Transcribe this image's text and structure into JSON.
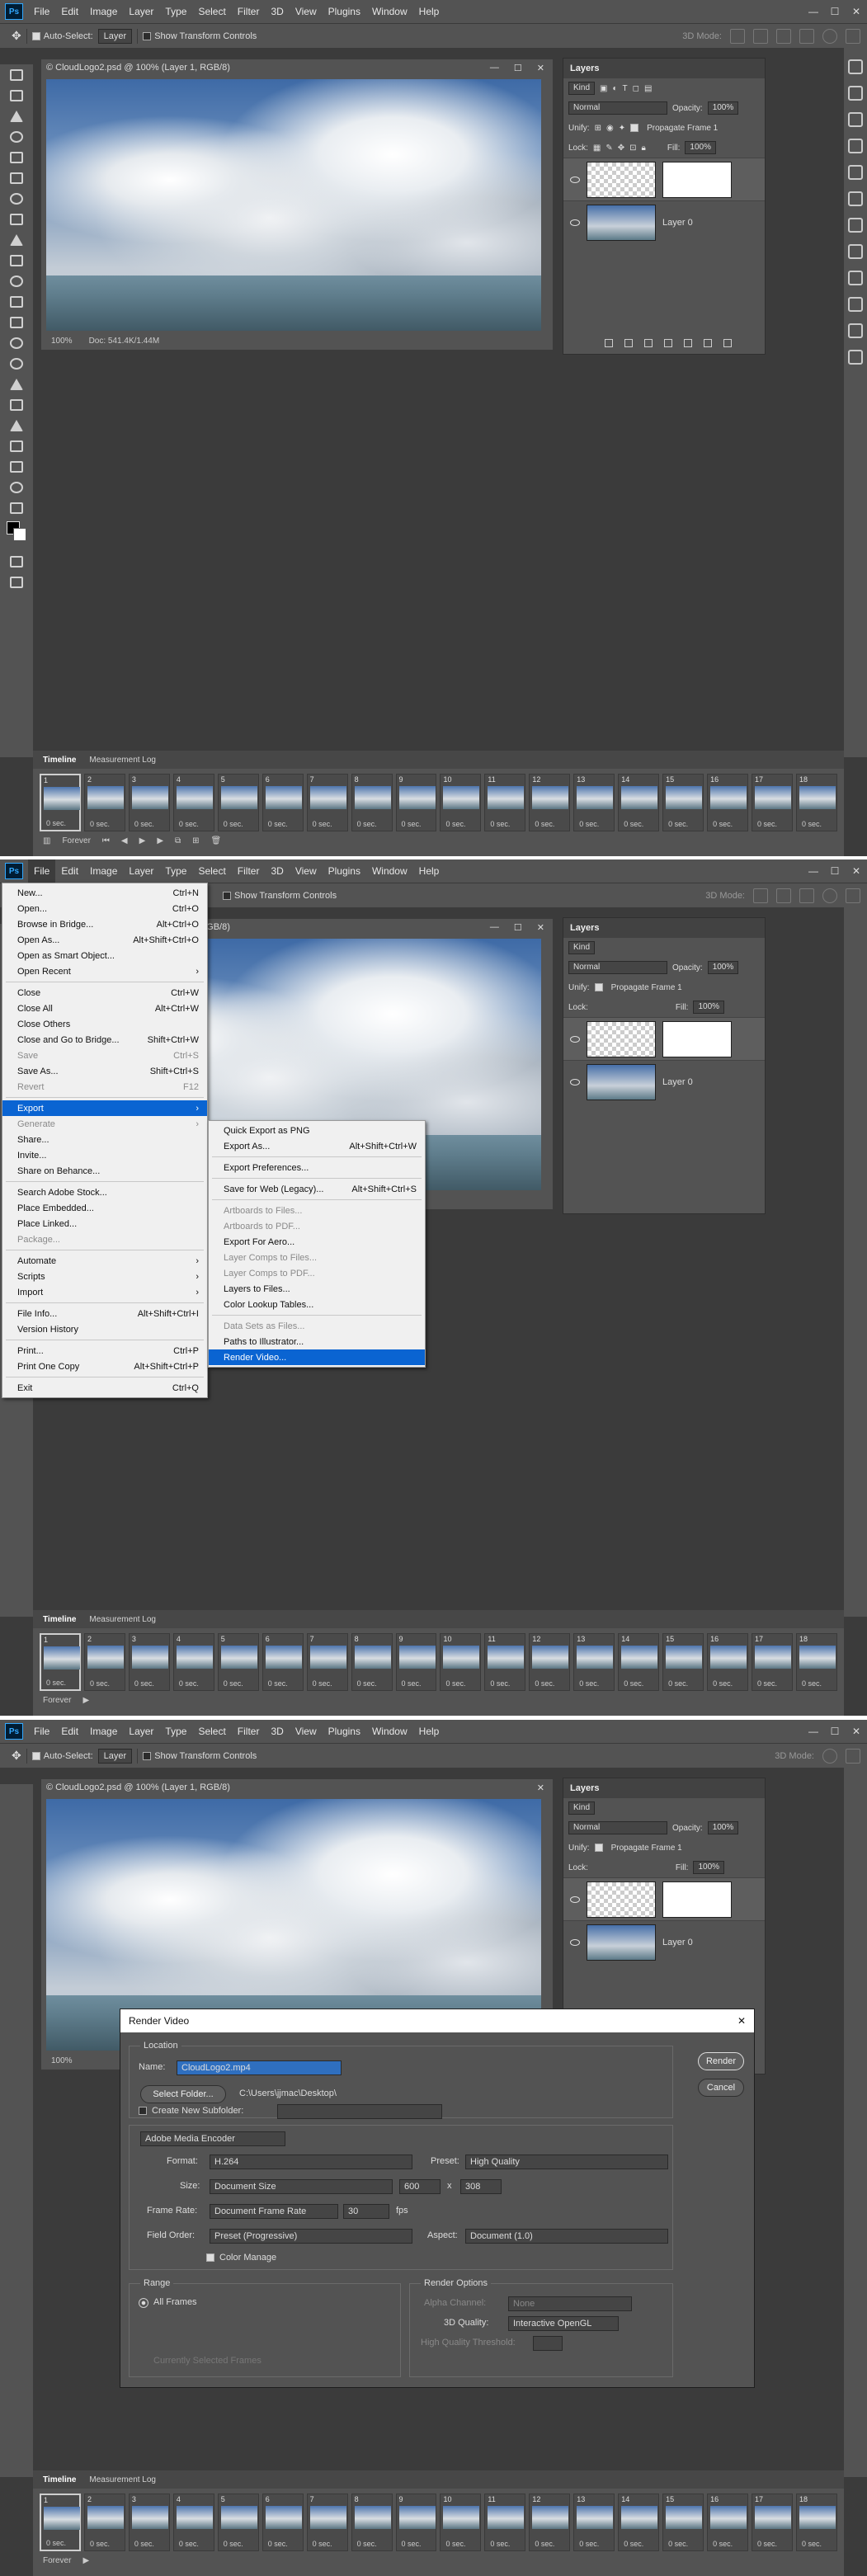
{
  "app": {
    "logo": "Ps",
    "menu": [
      "File",
      "Edit",
      "Image",
      "Layer",
      "Type",
      "Select",
      "Filter",
      "3D",
      "View",
      "Plugins",
      "Window",
      "Help"
    ],
    "window_controls": [
      "—",
      "☐",
      "✕"
    ]
  },
  "options_bar": {
    "auto_select": "Auto-Select:",
    "auto_select_target": "Layer",
    "show_transform": "Show Transform Controls",
    "mode_3d": "3D Mode:"
  },
  "document": {
    "tab_title": "© CloudLogo2.psd @ 100% (Layer 1, RGB/8)",
    "zoom": "100%",
    "doc_info": "Doc: 541.4K/1.44M"
  },
  "layers_panel": {
    "title": "Layers",
    "filter_label": "Kind",
    "blend_mode": "Normal",
    "opacity_label": "Opacity:",
    "opacity_value": "100%",
    "unify_label": "Unify:",
    "propagate_label": "Propagate Frame 1",
    "lock_label": "Lock:",
    "fill_label": "Fill:",
    "fill_value": "100%",
    "layers": [
      {
        "name": ""
      },
      {
        "name": "Layer 0"
      }
    ]
  },
  "timeline": {
    "tabs": [
      "Timeline",
      "Measurement Log"
    ],
    "frame_numbers": [
      "1",
      "2",
      "3",
      "4",
      "5",
      "6",
      "7",
      "8",
      "9",
      "10",
      "11",
      "12",
      "13",
      "14",
      "15",
      "16",
      "17",
      "18"
    ],
    "frame_delay": "0 sec.",
    "loop": "Forever"
  },
  "file_menu": {
    "items": [
      {
        "label": "New...",
        "shortcut": "Ctrl+N"
      },
      {
        "label": "Open...",
        "shortcut": "Ctrl+O"
      },
      {
        "label": "Browse in Bridge...",
        "shortcut": "Alt+Ctrl+O"
      },
      {
        "label": "Open As...",
        "shortcut": "Alt+Shift+Ctrl+O"
      },
      {
        "label": "Open as Smart Object...",
        "shortcut": ""
      },
      {
        "label": "Open Recent",
        "shortcut": "›"
      },
      {
        "sep": true
      },
      {
        "label": "Close",
        "shortcut": "Ctrl+W"
      },
      {
        "label": "Close All",
        "shortcut": "Alt+Ctrl+W"
      },
      {
        "label": "Close Others",
        "shortcut": ""
      },
      {
        "label": "Close and Go to Bridge...",
        "shortcut": "Shift+Ctrl+W"
      },
      {
        "label": "Save",
        "shortcut": "Ctrl+S",
        "dis": true
      },
      {
        "label": "Save As...",
        "shortcut": "Shift+Ctrl+S"
      },
      {
        "label": "Revert",
        "shortcut": "F12",
        "dis": true
      },
      {
        "sep": true
      },
      {
        "label": "Export",
        "shortcut": "›",
        "act": true
      },
      {
        "label": "Generate",
        "shortcut": "›",
        "dis": true
      },
      {
        "label": "Share...",
        "shortcut": ""
      },
      {
        "label": "Invite...",
        "shortcut": ""
      },
      {
        "label": "Share on Behance...",
        "shortcut": ""
      },
      {
        "sep": true
      },
      {
        "label": "Search Adobe Stock...",
        "shortcut": ""
      },
      {
        "label": "Place Embedded...",
        "shortcut": ""
      },
      {
        "label": "Place Linked...",
        "shortcut": ""
      },
      {
        "label": "Package...",
        "shortcut": "",
        "dis": true
      },
      {
        "sep": true
      },
      {
        "label": "Automate",
        "shortcut": "›"
      },
      {
        "label": "Scripts",
        "shortcut": "›"
      },
      {
        "label": "Import",
        "shortcut": "›"
      },
      {
        "sep": true
      },
      {
        "label": "File Info...",
        "shortcut": "Alt+Shift+Ctrl+I"
      },
      {
        "label": "Version History",
        "shortcut": ""
      },
      {
        "sep": true
      },
      {
        "label": "Print...",
        "shortcut": "Ctrl+P"
      },
      {
        "label": "Print One Copy",
        "shortcut": "Alt+Shift+Ctrl+P"
      },
      {
        "sep": true
      },
      {
        "label": "Exit",
        "shortcut": "Ctrl+Q"
      }
    ]
  },
  "export_menu": {
    "items": [
      {
        "label": "Quick Export as PNG",
        "shortcut": ""
      },
      {
        "label": "Export As...",
        "shortcut": "Alt+Shift+Ctrl+W"
      },
      {
        "sep": true
      },
      {
        "label": "Export Preferences...",
        "shortcut": ""
      },
      {
        "sep": true
      },
      {
        "label": "Save for Web (Legacy)...",
        "shortcut": "Alt+Shift+Ctrl+S"
      },
      {
        "sep": true
      },
      {
        "label": "Artboards to Files...",
        "shortcut": "",
        "dis": true
      },
      {
        "label": "Artboards to PDF...",
        "shortcut": "",
        "dis": true
      },
      {
        "label": "Export For Aero...",
        "shortcut": ""
      },
      {
        "label": "Layer Comps to Files...",
        "shortcut": "",
        "dis": true
      },
      {
        "label": "Layer Comps to PDF...",
        "shortcut": "",
        "dis": true
      },
      {
        "label": "Layers to Files...",
        "shortcut": ""
      },
      {
        "label": "Color Lookup Tables...",
        "shortcut": ""
      },
      {
        "sep": true
      },
      {
        "label": "Data Sets as Files...",
        "shortcut": "",
        "dis": true
      },
      {
        "label": "Paths to Illustrator...",
        "shortcut": ""
      },
      {
        "label": "Render Video...",
        "shortcut": "",
        "act": true
      }
    ]
  },
  "render_dialog": {
    "title": "Render Video",
    "close": "✕",
    "location_label": "Location",
    "name_label": "Name:",
    "name_value": "CloudLogo2.mp4",
    "select_folder": "Select Folder...",
    "folder_path": "C:\\Users\\jjmac\\Desktop\\",
    "create_subfolder": "Create New Subfolder:",
    "render_btn": "Render",
    "cancel_btn": "Cancel",
    "encoder": "Adobe Media Encoder",
    "format_label": "Format:",
    "format_value": "H.264",
    "preset_label": "Preset:",
    "preset_value": "High Quality",
    "size_label": "Size:",
    "size_value": "Document Size",
    "width": "600",
    "x": "x",
    "height": "308",
    "framerate_label": "Frame Rate:",
    "framerate_value": "Document Frame Rate",
    "fps_value": "30",
    "fps_label": "fps",
    "fieldorder_label": "Field Order:",
    "fieldorder_value": "Preset (Progressive)",
    "aspect_label": "Aspect:",
    "aspect_value": "Document (1.0)",
    "color_manage": "Color Manage",
    "range_label": "Range",
    "all_frames": "All Frames",
    "current_frames": "Currently Selected Frames",
    "render_options": "Render Options",
    "alpha_label": "Alpha Channel:",
    "alpha_value": "None",
    "quality3d_label": "3D Quality:",
    "quality3d_value": "Interactive OpenGL",
    "hq_label": "High Quality Threshold:"
  }
}
